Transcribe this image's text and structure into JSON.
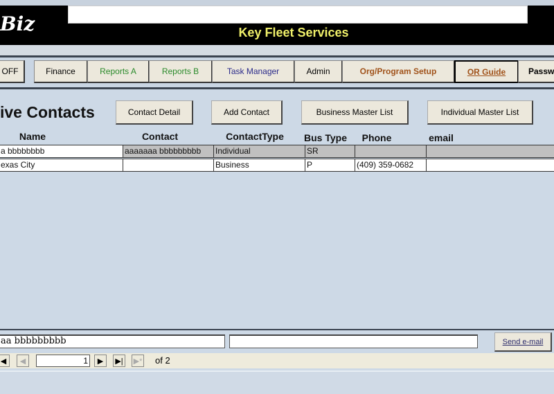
{
  "header": {
    "logo": "Biz",
    "title": "Key Fleet Services",
    "search_value": ""
  },
  "nav": [
    {
      "label": "OFF",
      "color": "#111111"
    },
    {
      "label": "Finance",
      "color": "#111111"
    },
    {
      "label": "Reports A",
      "color": "#2a8a2a"
    },
    {
      "label": "Reports B",
      "color": "#2a8a2a"
    },
    {
      "label": "Task Manager",
      "color": "#2a2a8a"
    },
    {
      "label": "Admin",
      "color": "#111111"
    },
    {
      "label": "Org/Program Setup",
      "color": "#a0521a"
    },
    {
      "label": "OR Guide",
      "color": "#a0521a"
    },
    {
      "label": "Passw",
      "color": "#111111"
    }
  ],
  "main": {
    "heading": "ive Contacts",
    "buttons": {
      "contact_detail": "Contact Detail",
      "add_contact": "Add Contact",
      "business_master": "Business Master List",
      "individual_master": "Individual Master List"
    },
    "columns": [
      "Name",
      "Contact",
      "ContactType",
      "Bus Type",
      "Phone",
      "email"
    ],
    "rows": [
      [
        "a bbbbbbbb",
        "aaaaaaa bbbbbbbbb",
        "Individual",
        "SR",
        "",
        ""
      ],
      [
        "exas City",
        "",
        "Business",
        "P",
        "(409) 359-0682",
        ""
      ]
    ]
  },
  "footer": {
    "name_field": "aa bbbbbbbbb",
    "email_field": "",
    "send_email": "Send e-mail",
    "record_current": "1",
    "record_of": "of 2"
  }
}
